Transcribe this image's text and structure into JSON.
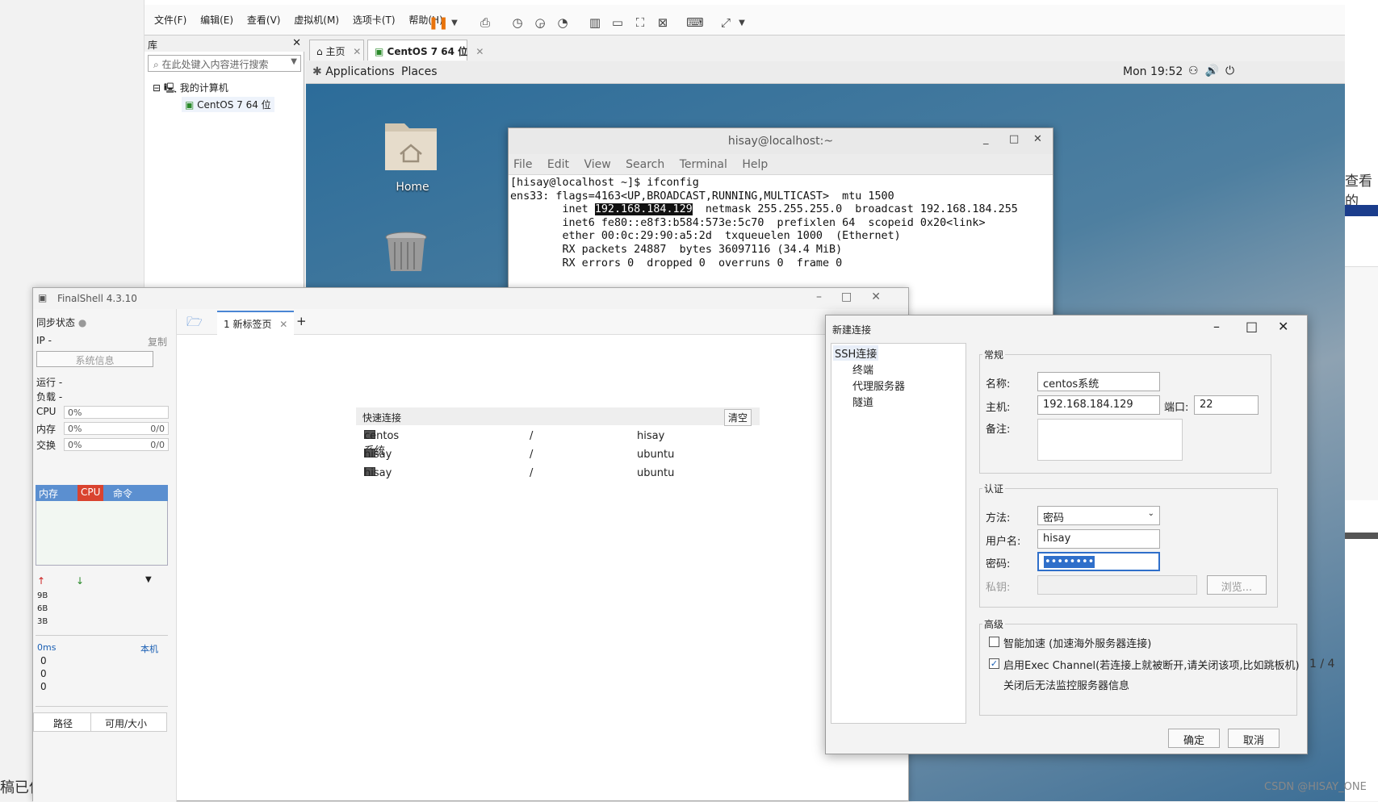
{
  "left_cut_text": "稿已保",
  "vmware": {
    "menu": [
      "文件(F)",
      "编辑(E)",
      "查看(V)",
      "虚拟机(M)",
      "选项卡(T)",
      "帮助(H)"
    ],
    "library": {
      "title": "库",
      "search_placeholder": "在此处键入内容进行搜索",
      "tree_root": "我的计算机",
      "tree_vm": "CentOS 7 64 位"
    },
    "tabs": {
      "home": "主页",
      "vm": "CentOS 7 64 位"
    }
  },
  "centos": {
    "applications": "Applications",
    "places": "Places",
    "clock": "Mon 19:52",
    "home_label": "Home",
    "terminal": {
      "title": "hisay@localhost:~",
      "menu": [
        "File",
        "Edit",
        "View",
        "Search",
        "Terminal",
        "Help"
      ],
      "line1": "[hisay@localhost ~]$ ifconfig",
      "line2": "ens33: flags=4163<UP,BROADCAST,RUNNING,MULTICAST>  mtu 1500",
      "line3a": "        inet ",
      "ip": "192.168.184.129",
      "line3b": "  netmask 255.255.255.0  broadcast 192.168.184.255",
      "line4": "        inet6 fe80::e8f3:b584:573e:5c70  prefixlen 64  scopeid 0x20<link>",
      "line5": "        ether 00:0c:29:90:a5:2d  txqueuelen 1000  (Ethernet)",
      "line6": "        RX packets 24887  bytes 36097116 (34.4 MiB)",
      "line7": "        RX errors 0  dropped 0  overruns 0  frame 0"
    }
  },
  "finalshell": {
    "title": "FinalShell 4.3.10",
    "sync": "同步状态",
    "ip_label": "IP  -",
    "copy": "复制",
    "sysinfo": "系统信息",
    "run": "运行 -",
    "load": "负载 -",
    "cpu_label": "CPU",
    "cpu_val": "0%",
    "mem_label": "内存",
    "mem_val": "0%",
    "mem_r": "0/0",
    "swap_label": "交换",
    "swap_val": "0%",
    "swap_r": "0/0",
    "proc_tabs": [
      "内存",
      "CPU",
      "命令"
    ],
    "net_ticks": [
      "9B",
      "6B",
      "3B"
    ],
    "ping": "0ms",
    "local": "本机",
    "ping_vals": [
      "0",
      "0",
      "0"
    ],
    "path": "路径",
    "avail": "可用/大小",
    "tab": "1 新标签页",
    "quick": {
      "title": "快速连接",
      "clear": "清空",
      "rows": [
        {
          "name": "centos系统",
          "path": "/",
          "user": "hisay"
        },
        {
          "name": "hisay",
          "path": "/",
          "user": "ubuntu"
        },
        {
          "name": "hisay",
          "path": "/",
          "user": "ubuntu"
        }
      ]
    }
  },
  "dialog": {
    "title": "新建连接",
    "tree": [
      "SSH连接",
      "终端",
      "代理服务器",
      "隧道"
    ],
    "general": "常规",
    "name_label": "名称:",
    "name_val": "centos系统",
    "host_label": "主机:",
    "host_val": "192.168.184.129",
    "port_label": "端口:",
    "port_val": "22",
    "note_label": "备注:",
    "auth": "认证",
    "method_label": "方法:",
    "method_val": "密码",
    "user_label": "用户名:",
    "user_val": "hisay",
    "pwd_label": "密码:",
    "pwd_val": "••••••••",
    "key_label": "私钥:",
    "browse": "浏览...",
    "advanced": "高级",
    "smart": "智能加速 (加速海外服务器连接)",
    "exec": "启用Exec Channel(若连接上就被断开,请关闭该项,比如跳板机)",
    "exec_note": "关闭后无法监控服务器信息",
    "ok": "确定",
    "cancel": "取消"
  },
  "right_strip": {
    "text": "查看的",
    "page": "1 / 4"
  },
  "watermark": "CSDN @HISAY_ONE"
}
